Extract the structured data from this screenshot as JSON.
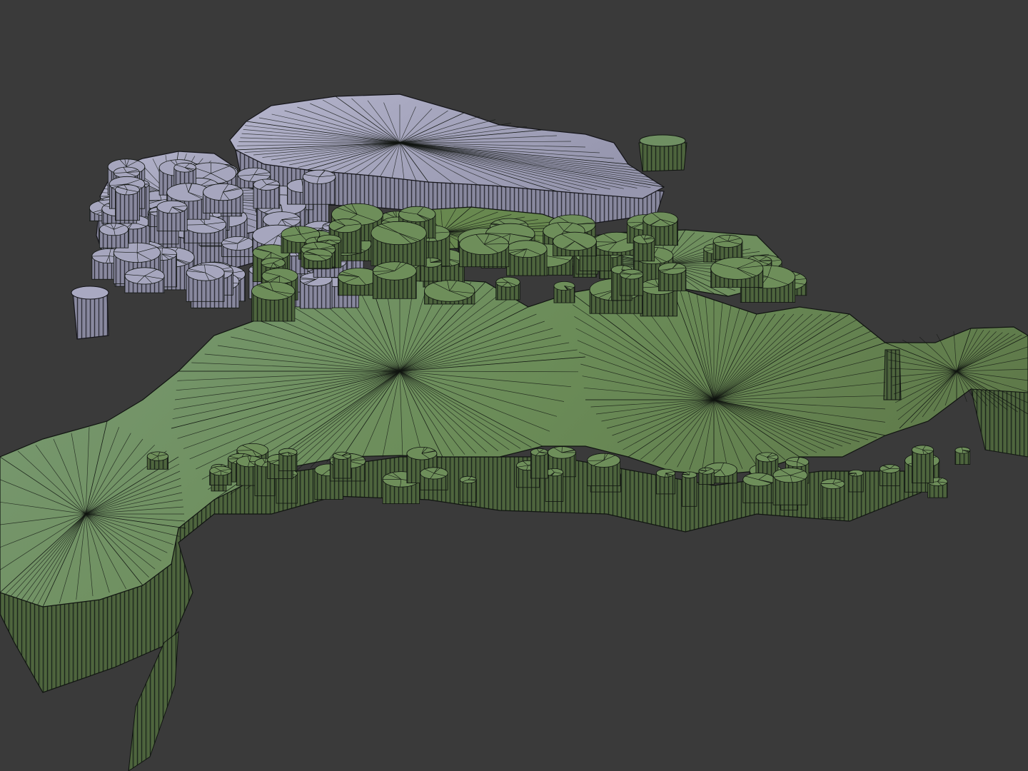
{
  "scene": {
    "background_color": "#3a3a3a",
    "wire_color": "#111511",
    "continent_main": {
      "top_color_a": "#7a9a74",
      "top_color_b": "#627e4c",
      "side_color": "#465c39"
    },
    "continent_north": {
      "top_color": "#a3a3bb",
      "side_color": "#7d7d92"
    },
    "view": "3d-viewport-wireframe-extruded-map"
  }
}
